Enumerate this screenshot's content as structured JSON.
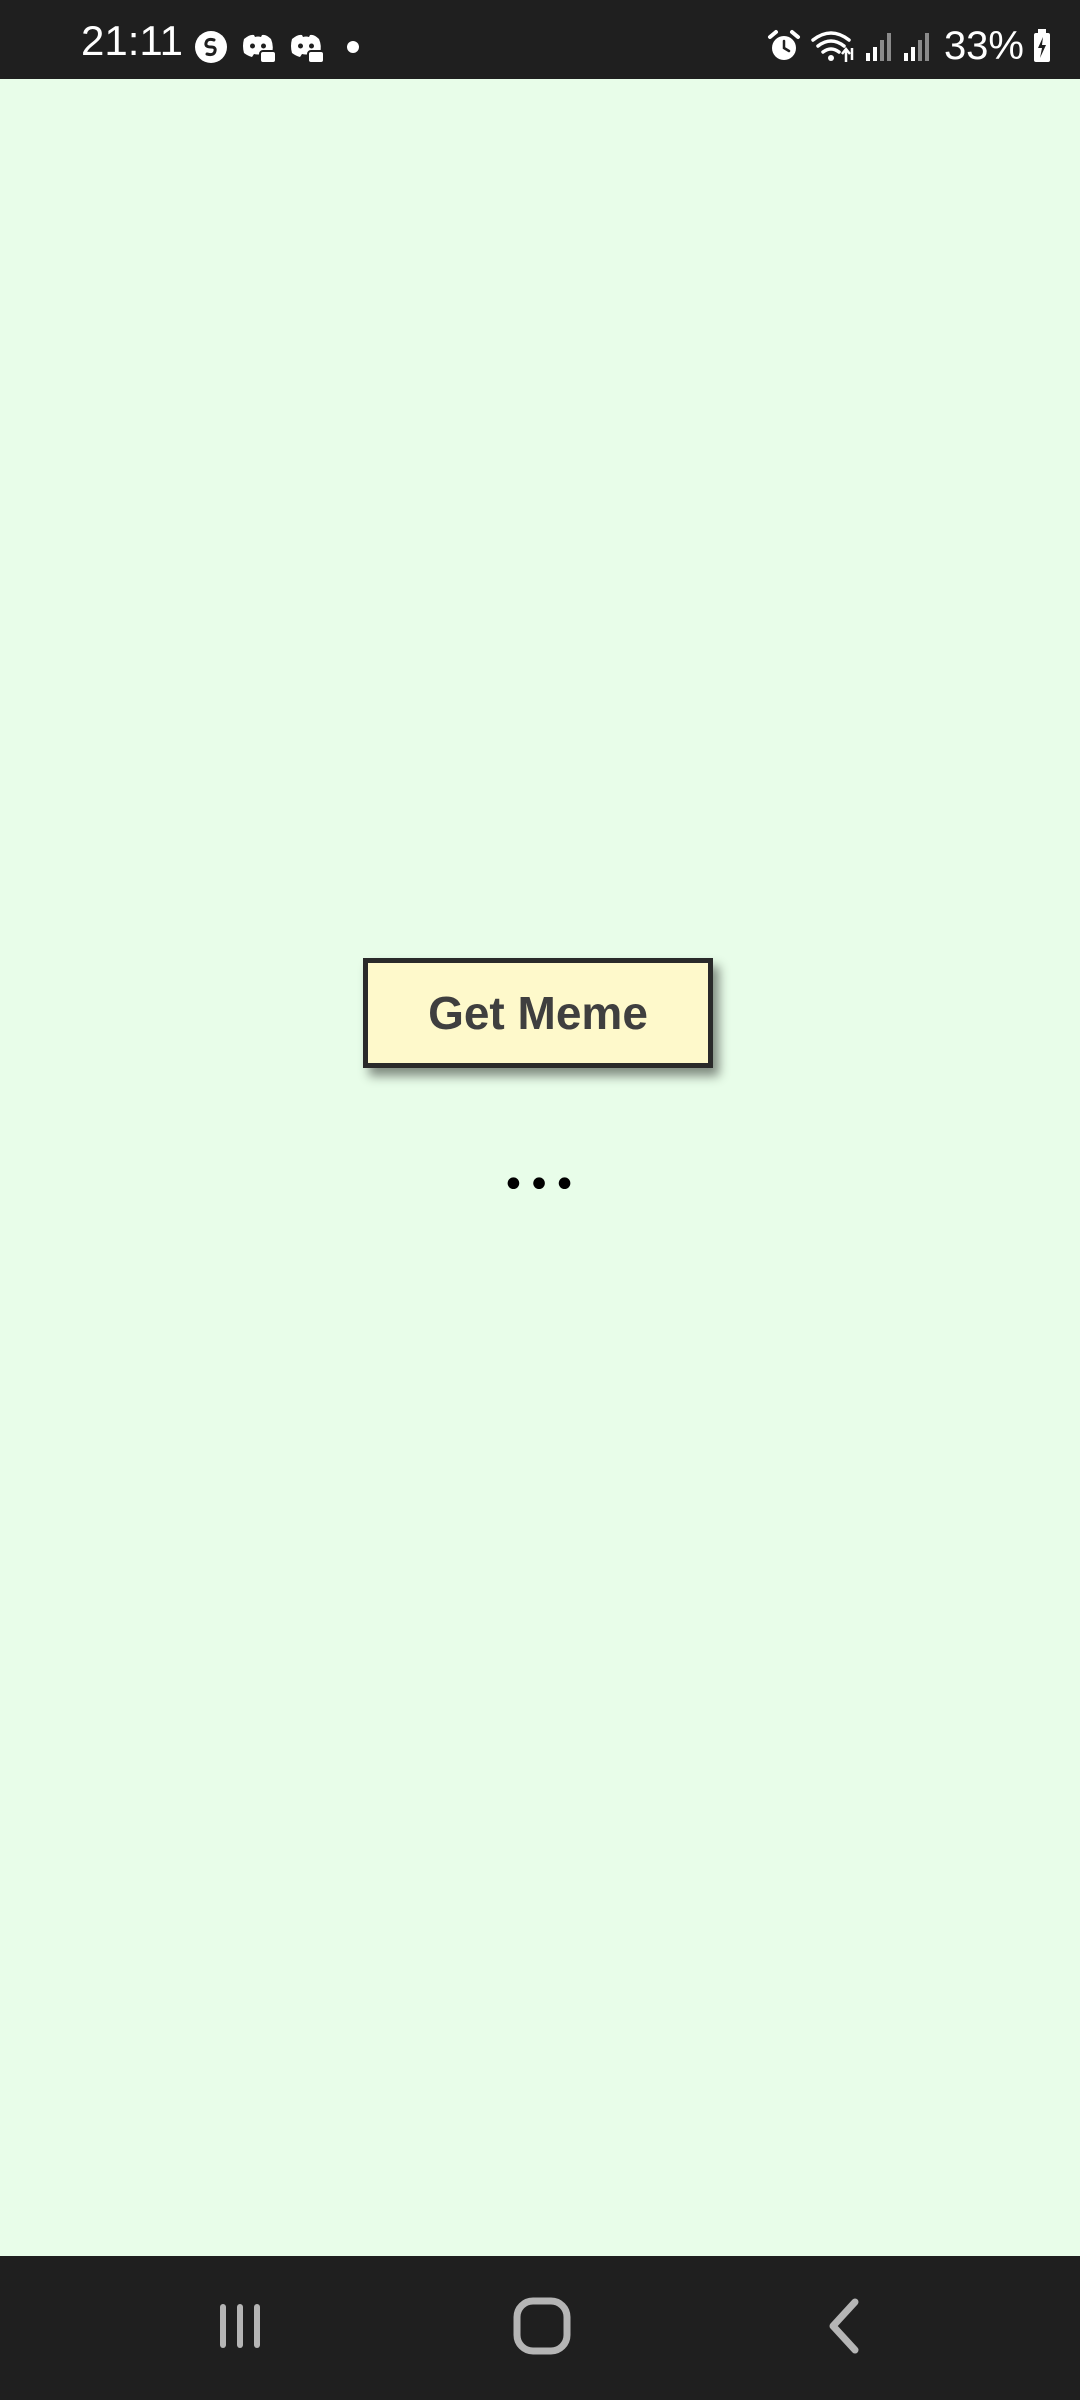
{
  "status_bar": {
    "time": "21:11",
    "battery": "33%",
    "left_icons": [
      "shazam-icon",
      "discord-icon",
      "discord-icon",
      "notification-dot-icon"
    ],
    "right_icons": [
      "alarm-icon",
      "wifi-icon",
      "signal-icon",
      "signal-icon",
      "battery-charging-icon"
    ]
  },
  "main": {
    "button_label": "Get Meme",
    "loading_text": "•••"
  },
  "nav_bar": {
    "icons": [
      "recent-apps-icon",
      "home-icon",
      "back-icon"
    ]
  },
  "colors": {
    "background": "#e8fde9",
    "button_bg": "#fef9cb",
    "button_border": "#2a2a2a",
    "button_text": "#3f3f3f",
    "bars": "#1f1f1f"
  }
}
